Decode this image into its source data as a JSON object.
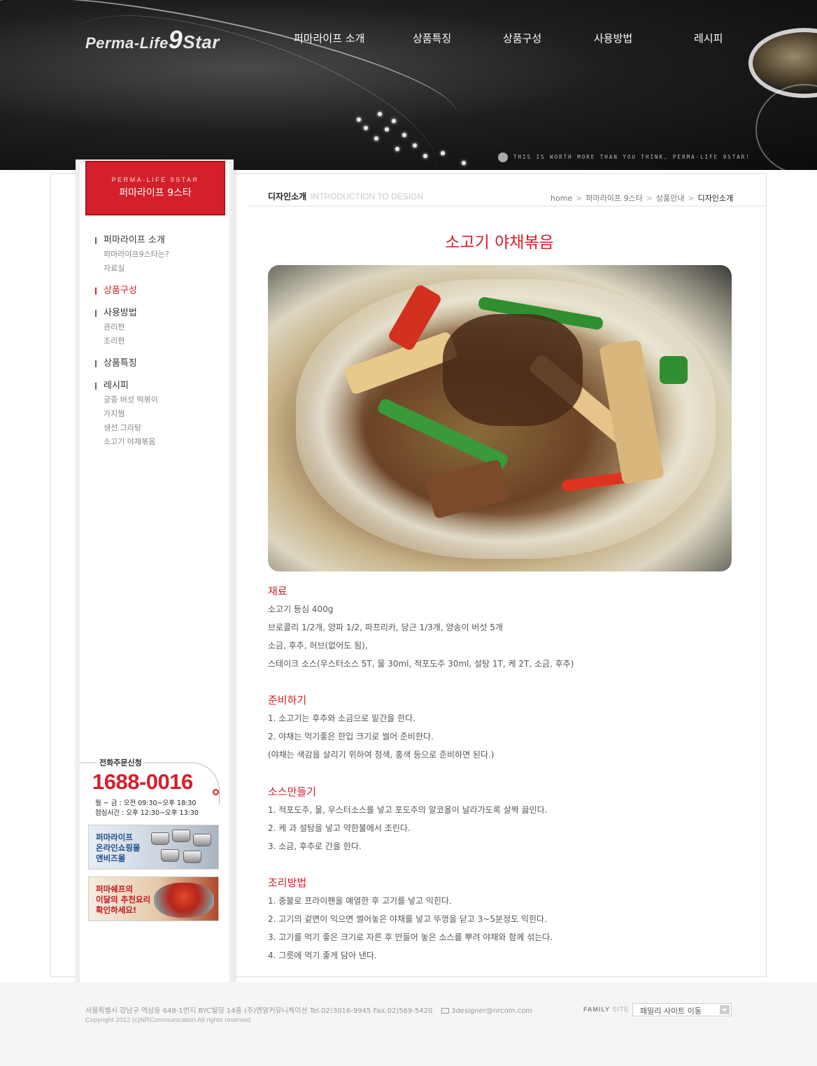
{
  "header": {
    "logo": {
      "brand": "Perma-Life",
      "mark": "9",
      "star": "Star"
    },
    "nav": [
      {
        "label": "퍼마라이프 소개"
      },
      {
        "label": "상품특징"
      },
      {
        "label": "상품구성"
      },
      {
        "label": "사용방법"
      },
      {
        "label": "레시피"
      }
    ],
    "tagline": "THIS IS WORTH MORE THAN YOU THINK, PERMA-LIFE 9STAR!"
  },
  "sidebar": {
    "title_en": "PERMA-LIFE 9STAR",
    "title_ko": "퍼마라이프 9스타",
    "menu": [
      {
        "label": "퍼마라이프 소개",
        "active": false,
        "subs": [
          "퍼마라이프9스타는?",
          "자료실"
        ]
      },
      {
        "label": "상품구성",
        "active": true,
        "subs": []
      },
      {
        "label": "사용방법",
        "active": false,
        "subs": [
          "관리편",
          "조리편"
        ]
      },
      {
        "label": "상품특징",
        "active": false,
        "subs": []
      },
      {
        "label": "레시피",
        "active": false,
        "subs": [
          "궁중 버섯 떡볶이",
          "가지찜",
          "생선 그라탕",
          "소고기 야채볶음"
        ]
      }
    ],
    "phone": {
      "label": "전화주문신청",
      "number": "1688-0016",
      "hours1": "월 ~ 금 : 오전 09:30~오후 18:30",
      "hours2": "점심시간 : 오후 12:30~오후 13:30"
    },
    "banner1": {
      "line1": "퍼마라이프",
      "line2": "온라인쇼핑몰",
      "line3": "앤비즈몰"
    },
    "banner2": {
      "line1": "퍼마쉐프의",
      "line2": "이달의 추천요리",
      "line3": "확인하세요!"
    }
  },
  "location": {
    "title": "디자인소개",
    "title_en": "INTRODUCTION TO DESIGN",
    "breadcrumb": [
      "home",
      "퍼마라이프 9스타",
      "상품안내",
      "디자인소개"
    ]
  },
  "recipe": {
    "title": "소고기 야채볶음",
    "sections": [
      {
        "heading": "재료",
        "lines": [
          "소고기 등심 400g",
          "브로콜리 1/2개, 양파 1/2, 파프리카, 당근 1/3개, 양송이 버섯 5개",
          "소금, 후추, 허브(없어도 됨),",
          "스테이크 소스(우스터소스 5T, 물 30ml, 적포도주 30ml, 설탕 1T, 케    2T, 소금, 후추)"
        ]
      },
      {
        "heading": "준비하기",
        "lines": [
          "1. 소고기는 후추와 소금으로 밑간을 한다.",
          "2. 야채는 먹기좋은 한입 크기로 썰어 준비한다.",
          "(야채는 색감을 살리기 위하여 청색, 홍색 등으로 준비하면 된다.)"
        ]
      },
      {
        "heading": "소스만들기",
        "lines": [
          "1. 적포도주, 물, 우스터소스를 넣고 포도주의 알코올이 날라가도록 살짝 끓인다.",
          "2. 케    과 설탕을 넣고 약한불에서 조린다.",
          "3. 소금, 후추로 간을 한다."
        ]
      },
      {
        "heading": "조리방법",
        "lines": [
          "1. 중불로 프라이팬을 예열한 후 고기를 넣고 익힌다.",
          "2. 고기의 겉면이 익으면 썰어놓은 야채를 넣고 뚜껑을 닫고 3~5분정도 익힌다.",
          "3. 고기를 먹기 좋은 크기로 자른 후 만들어 놓은 소스를 뿌려 야채와 함께 섞는다.",
          "4. 그릇에 먹기 좋게 담아 낸다."
        ]
      }
    ]
  },
  "footer": {
    "address": "서울특별시 강남구 역삼동 648-1번지 BYC빌딩 14층 (주)엔알커뮤니케이션    Tel.02)3016-9945    Fax.02)569-5420",
    "email": "3designer@nrcom.com",
    "copyright": "Copyright 2012 (c)NRCommunication  All rights reserved.",
    "family_label_a": "FAMILY",
    "family_label_b": "SITE",
    "family_select": "패밀리 사이트 이동"
  },
  "colors": {
    "accent": "#d4202a",
    "header_bg": "#111111",
    "footer_bg": "#f5f5f5"
  }
}
